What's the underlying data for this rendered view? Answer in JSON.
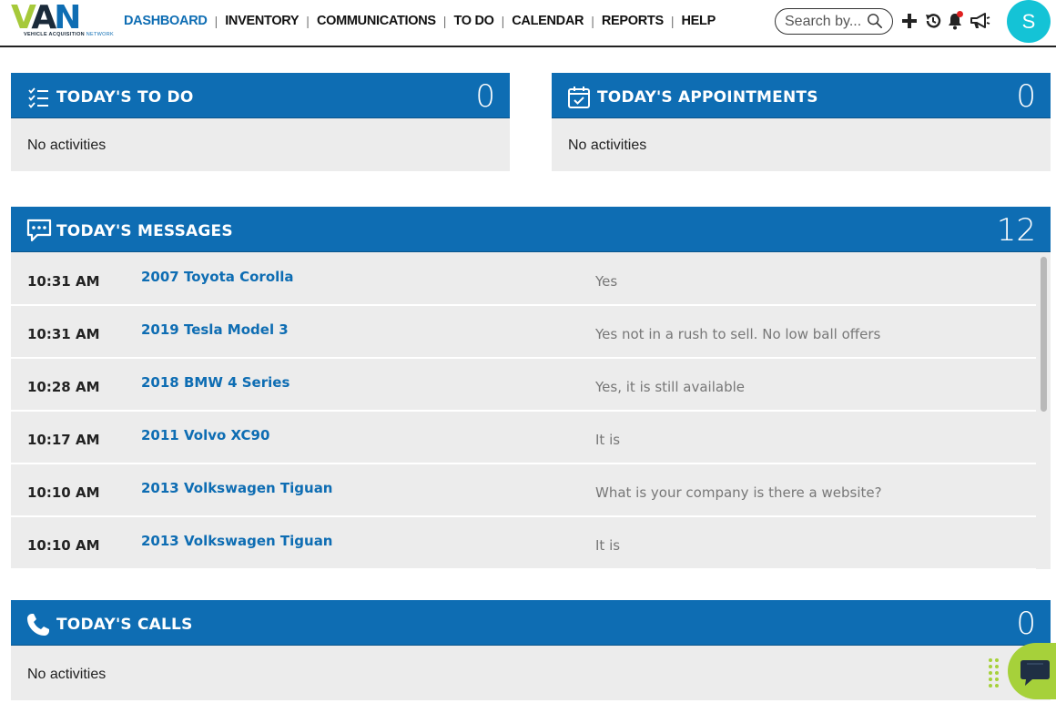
{
  "logo": {
    "letters_v": "V",
    "letters_a": "A",
    "letters_n": "N",
    "tagline_strong": "VEHICLE ACQUISITION",
    "tagline_rest": "NETWORK"
  },
  "nav": {
    "items": [
      {
        "label": "DASHBOARD",
        "active": true
      },
      {
        "label": "INVENTORY"
      },
      {
        "label": "COMMUNICATIONS"
      },
      {
        "label": "TO DO"
      },
      {
        "label": "CALENDAR"
      },
      {
        "label": "REPORTS"
      },
      {
        "label": "HELP"
      }
    ],
    "separator": "|"
  },
  "search": {
    "placeholder": "Search by..."
  },
  "header_icons": [
    "plus-icon",
    "history-icon",
    "bell-icon",
    "megaphone-icon"
  ],
  "user": {
    "initial": "S",
    "avatar_color": "#14c3d6"
  },
  "colors": {
    "primary": "#0e6db3",
    "panel_bg": "#ececec",
    "accent_green": "#a6d13a"
  },
  "todo": {
    "title": "TODAY'S TO DO",
    "count": "0",
    "empty": "No activities",
    "icon": "checklist-icon"
  },
  "appointments": {
    "title": "TODAY'S APPOINTMENTS",
    "count": "0",
    "empty": "No activities",
    "icon": "calendar-check-icon"
  },
  "messages": {
    "title": "TODAY'S MESSAGES",
    "count": "12",
    "icon": "chat-bubble-icon",
    "rows": [
      {
        "time": "10:31 AM",
        "vehicle": "2007 Toyota Corolla",
        "text": "Yes"
      },
      {
        "time": "10:31 AM",
        "vehicle": "2019 Tesla Model 3",
        "text": "Yes not in a rush to sell. No low ball offers"
      },
      {
        "time": "10:28 AM",
        "vehicle": "2018 BMW 4 Series",
        "text": "Yes, it is still available"
      },
      {
        "time": "10:17 AM",
        "vehicle": "2011 Volvo XC90",
        "text": "It is"
      },
      {
        "time": "10:10 AM",
        "vehicle": "2013 Volkswagen Tiguan",
        "text": "What is your company is there a website?"
      },
      {
        "time": "10:10 AM",
        "vehicle": "2013 Volkswagen Tiguan",
        "text": "It is"
      }
    ]
  },
  "calls": {
    "title": "TODAY'S CALLS",
    "count": "0",
    "empty": "No activities",
    "icon": "phone-icon"
  },
  "chat_widget": {
    "icon": "chat-widget-icon"
  }
}
